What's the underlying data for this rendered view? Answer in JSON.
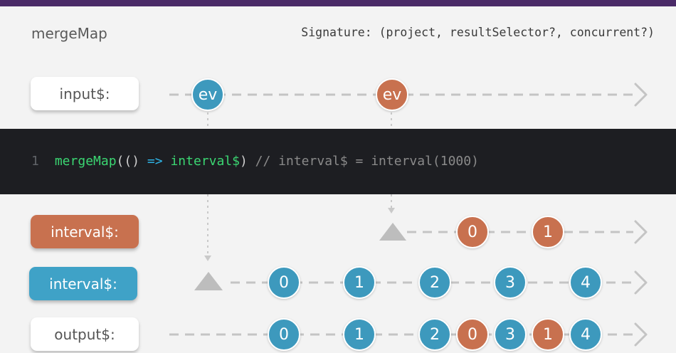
{
  "title": "mergeMap",
  "signature": "Signature: (project, resultSelector?, concurrent?)",
  "code": {
    "line_number": "1",
    "fn": "mergeMap",
    "open": "((",
    "paren_close": ")",
    "arrow": " => ",
    "arg": "interval$",
    "close": ")",
    "comment": " // interval$ = interval(1000)"
  },
  "labels": {
    "input": "input$:",
    "interval_orange": "interval$:",
    "interval_blue": "interval$:",
    "output": "output$:"
  },
  "marbles": {
    "input": [
      {
        "text": "ev",
        "color": "blue"
      },
      {
        "text": "ev",
        "color": "orange"
      }
    ],
    "interval_orange": [
      "0",
      "1"
    ],
    "interval_blue": [
      "0",
      "1",
      "2",
      "3",
      "4"
    ],
    "output": [
      {
        "text": "0",
        "color": "blue"
      },
      {
        "text": "1",
        "color": "blue"
      },
      {
        "text": "2",
        "color": "blue"
      },
      {
        "text": "0",
        "color": "orange"
      },
      {
        "text": "3",
        "color": "blue"
      },
      {
        "text": "1",
        "color": "orange"
      },
      {
        "text": "4",
        "color": "blue"
      }
    ]
  },
  "colors": {
    "blue": "#3d99bd",
    "orange": "#c8714f",
    "line": "#c4c4c4",
    "code_bg": "#1d1e22"
  }
}
